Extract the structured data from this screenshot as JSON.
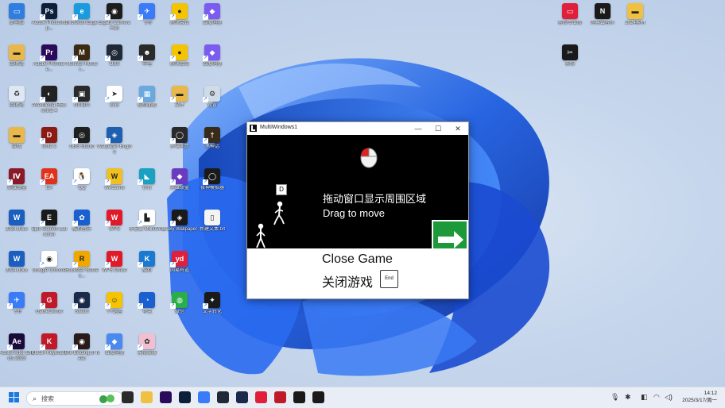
{
  "desktop": {
    "icons": [
      {
        "label": "此电脑",
        "color": "#2f7de0",
        "glyph": "▭",
        "col": 0,
        "row": 0,
        "shortcut": false
      },
      {
        "label": "Adobe Photoshop...",
        "color": "#0b1f3a",
        "glyph": "Ps",
        "col": 1,
        "row": 0,
        "shortcut": true
      },
      {
        "label": "Microsoft Edge",
        "color": "#1a9be0",
        "glyph": "e",
        "col": 2,
        "row": 0,
        "shortcut": true
      },
      {
        "label": "Elgato Camera Hub",
        "color": "#1d1d1d",
        "glyph": "◉",
        "col": 3,
        "row": 0,
        "shortcut": true
      },
      {
        "label": "飞书",
        "color": "#3a7bfa",
        "glyph": "✈",
        "col": 4,
        "row": 0,
        "shortcut": true
      },
      {
        "label": "腾讯会议",
        "color": "#f5c400",
        "glyph": "●",
        "col": 5,
        "row": 0,
        "shortcut": true
      },
      {
        "label": "百度网盘",
        "color": "#7a5cf0",
        "glyph": "◆",
        "col": 6,
        "row": 0,
        "shortcut": true
      },
      {
        "label": "Adobe Premiere...",
        "color": "#2a0a5a",
        "glyph": "Pr",
        "col": 1,
        "row": 1,
        "shortcut": true
      },
      {
        "label": "回收站",
        "color": "#e8b84a",
        "glyph": "▬",
        "col": 0,
        "row": 1,
        "shortcut": false
      },
      {
        "label": "Monster Hunter...",
        "color": "#3a2a12",
        "glyph": "M",
        "col": 2,
        "row": 1,
        "shortcut": true
      },
      {
        "label": "OBS",
        "color": "#1f2a36",
        "glyph": "◎",
        "col": 3,
        "row": 1,
        "shortcut": true
      },
      {
        "label": "哔哩",
        "color": "#2a2a2a",
        "glyph": "☻",
        "col": 4,
        "row": 1,
        "shortcut": true
      },
      {
        "label": "腾讯会议",
        "color": "#f5c400",
        "glyph": "●",
        "col": 5,
        "row": 1,
        "shortcut": true
      },
      {
        "label": "百度网盘",
        "color": "#7a5cf0",
        "glyph": "◆",
        "col": 6,
        "row": 1,
        "shortcut": true
      },
      {
        "label": "回收站",
        "color": "#dfe8f2",
        "glyph": "♻",
        "col": 0,
        "row": 2,
        "shortcut": false
      },
      {
        "label": "AVerMedia RECentral 4",
        "color": "#222",
        "glyph": "◐",
        "col": 1,
        "row": 2,
        "shortcut": true
      },
      {
        "label": "NVIDIA",
        "color": "#2a2a2a",
        "glyph": "▣",
        "col": 2,
        "row": 2,
        "shortcut": true
      },
      {
        "label": "钉钉",
        "color": "#ffffff",
        "glyph": "➤",
        "col": 3,
        "row": 2,
        "shortcut": true
      },
      {
        "label": "控制面板",
        "color": "#6aa9e0",
        "glyph": "▦",
        "col": 4,
        "row": 2,
        "shortcut": true
      },
      {
        "label": "文件",
        "color": "#e8b84a",
        "glyph": "▬",
        "col": 5,
        "row": 2,
        "shortcut": true
      },
      {
        "label": "设置",
        "color": "#d0dbe8",
        "glyph": "⚙",
        "col": 6,
        "row": 2,
        "shortcut": true
      },
      {
        "label": "游戏",
        "color": "#e8b84a",
        "glyph": "▬",
        "col": 0,
        "row": 3,
        "shortcut": false
      },
      {
        "label": "Dota 2",
        "color": "#8a1a12",
        "glyph": "D",
        "col": 1,
        "row": 3,
        "shortcut": true
      },
      {
        "label": "OBS Studio",
        "color": "#1f1f1f",
        "glyph": "◎",
        "col": 2,
        "row": 3,
        "shortcut": true
      },
      {
        "label": "Wallpaper Engine",
        "color": "#1f5fb0",
        "glyph": "◈",
        "col": 3,
        "row": 3,
        "shortcut": true
      },
      {
        "label": "多端同步",
        "color": "#2a2a2a",
        "glyph": "◯",
        "col": 5,
        "row": 3,
        "shortcut": true
      },
      {
        "label": "黑神话",
        "color": "#3a2a1a",
        "glyph": "†",
        "col": 6,
        "row": 3,
        "shortcut": true
      },
      {
        "label": "英雄联盟",
        "color": "#8a1a28",
        "glyph": "Ⅳ",
        "col": 0,
        "row": 4,
        "shortcut": true
      },
      {
        "label": "EA",
        "color": "#e0321a",
        "glyph": "EA",
        "col": 1,
        "row": 4,
        "shortcut": true
      },
      {
        "label": "QQ",
        "color": "#ffffff",
        "glyph": "🐧",
        "col": 2,
        "row": 4,
        "shortcut": true
      },
      {
        "label": "WeGame",
        "color": "#f0c020",
        "glyph": "W",
        "col": 3,
        "row": 4,
        "shortcut": true
      },
      {
        "label": "钉钉",
        "color": "#1aa0c0",
        "glyph": "◣",
        "col": 4,
        "row": 4,
        "shortcut": true
      },
      {
        "label": "英雄联盟",
        "color": "#6a3ac0",
        "glyph": "◆",
        "col": 5,
        "row": 4,
        "shortcut": true
      },
      {
        "label": "夜神模拟器",
        "color": "#1a1a1a",
        "glyph": "◯",
        "col": 6,
        "row": 4,
        "shortcut": true
      },
      {
        "label": "2024.docx",
        "color": "#1a5fc0",
        "glyph": "W",
        "col": 0,
        "row": 5,
        "shortcut": false
      },
      {
        "label": "Epic Games Launcher",
        "color": "#1a1a1a",
        "glyph": "E",
        "col": 1,
        "row": 5,
        "shortcut": true
      },
      {
        "label": "酷狗音乐",
        "color": "#1a5fd0",
        "glyph": "✿",
        "col": 2,
        "row": 5,
        "shortcut": true
      },
      {
        "label": "WPS",
        "color": "#e01a28",
        "glyph": "W",
        "col": 3,
        "row": 5,
        "shortcut": true
      },
      {
        "label": "多窗口 MultiWin..",
        "color": "#ffffff",
        "glyph": "▙",
        "col": 4,
        "row": 5,
        "shortcut": true
      },
      {
        "label": "Lively Wallpaper",
        "color": "#1a1a1a",
        "glyph": "◈",
        "col": 5,
        "row": 5,
        "shortcut": true
      },
      {
        "label": "新建文本.txt",
        "color": "#f4f4f4",
        "glyph": "▯",
        "col": 6,
        "row": 5,
        "shortcut": false
      },
      {
        "label": "2024.docx",
        "color": "#1a5fc0",
        "glyph": "W",
        "col": 0,
        "row": 6,
        "shortcut": false
      },
      {
        "label": "Google Chrome",
        "color": "#ffffff",
        "glyph": "◉",
        "col": 1,
        "row": 6,
        "shortcut": true
      },
      {
        "label": "Rockstar Games...",
        "color": "#f0a800",
        "glyph": "R",
        "col": 2,
        "row": 6,
        "shortcut": true
      },
      {
        "label": "WPS Office",
        "color": "#e01a28",
        "glyph": "W",
        "col": 3,
        "row": 6,
        "shortcut": true
      },
      {
        "label": "酷狗",
        "color": "#1a7ad0",
        "glyph": "K",
        "col": 4,
        "row": 6,
        "shortcut": true
      },
      {
        "label": "网易有道",
        "color": "#e0203a",
        "glyph": "yd",
        "col": 5,
        "row": 6,
        "shortcut": true
      },
      {
        "label": "飞书",
        "color": "#3a7bfa",
        "glyph": "✈",
        "col": 0,
        "row": 7,
        "shortcut": true
      },
      {
        "label": "GameCenter",
        "color": "#c01a28",
        "glyph": "G",
        "col": 1,
        "row": 7,
        "shortcut": true
      },
      {
        "label": "Steam",
        "color": "#1a2a4a",
        "glyph": "◉",
        "col": 2,
        "row": 7,
        "shortcut": true
      },
      {
        "label": "YY语音",
        "color": "#f5c400",
        "glyph": "☺",
        "col": 3,
        "row": 7,
        "shortcut": true
      },
      {
        "label": "夸克",
        "color": "#1a5fd0",
        "glyph": "◔",
        "col": 4,
        "row": 7,
        "shortcut": true
      },
      {
        "label": "微信",
        "color": "#2aae4a",
        "glyph": "◍",
        "col": 5,
        "row": 7,
        "shortcut": true
      },
      {
        "label": "文字转化",
        "color": "#1a1a1a",
        "glyph": "✦",
        "col": 6,
        "row": 7,
        "shortcut": true
      },
      {
        "label": "Adobe After Effects 2023",
        "color": "#1a0a3a",
        "glyph": "Ae",
        "col": 0,
        "row": 8,
        "shortcut": true
      },
      {
        "label": "KOOK Keyboard",
        "color": "#c01a28",
        "glyph": "K",
        "col": 1,
        "row": 8,
        "shortcut": true
      },
      {
        "label": "The Binding of Isaac",
        "color": "#2a1a1a",
        "glyph": "◉",
        "col": 2,
        "row": 8,
        "shortcut": true
      },
      {
        "label": "百度网盘",
        "color": "#4a8af0",
        "glyph": "◆",
        "col": 3,
        "row": 8,
        "shortcut": true
      },
      {
        "label": "无限暖暖",
        "color": "#f0c0d0",
        "glyph": "✿",
        "col": 4,
        "row": 8,
        "shortcut": true
      }
    ],
    "right_icons": [
      {
        "label": "剪映专业版",
        "color": "#e0203a",
        "glyph": "▭",
        "slot": 0
      },
      {
        "label": "网易云音乐",
        "color": "#1a1a1a",
        "glyph": "N",
        "slot": 1
      },
      {
        "label": "2024素材",
        "color": "#f0c040",
        "glyph": "▬",
        "slot": 2
      },
      {
        "label": "剪映",
        "color": "#1a1a1a",
        "glyph": "✂",
        "slot": 3
      }
    ]
  },
  "window": {
    "title": "MultiWindows1",
    "minimize": "—",
    "maximize": "☐",
    "close": "✕",
    "hint_cn": "拖动窗口显示周围区域",
    "hint_en": "Drag to move",
    "key_d": "D",
    "close_en": "Close Game",
    "close_cn": "关闭游戏",
    "end_key": "End"
  },
  "taskbar": {
    "search_placeholder": "搜索",
    "time": "14:12",
    "date": "2025/3/17/周一",
    "apps": [
      {
        "name": "task-view",
        "color": "#2a2a2a"
      },
      {
        "name": "file-explorer",
        "color": "#f0c040"
      },
      {
        "name": "premiere",
        "color": "#2a0a5a"
      },
      {
        "name": "photoshop",
        "color": "#0b1f3a"
      },
      {
        "name": "feishu",
        "color": "#3a7bfa"
      },
      {
        "name": "obs",
        "color": "#1f2a36"
      },
      {
        "name": "steam",
        "color": "#1a2a4a"
      },
      {
        "name": "jianying",
        "color": "#e0203a"
      },
      {
        "name": "netease-music",
        "color": "#c01a28"
      },
      {
        "name": "game-dev",
        "color": "#1a1a1a"
      },
      {
        "name": "multiwindows",
        "color": "#1a1a1a"
      }
    ]
  }
}
